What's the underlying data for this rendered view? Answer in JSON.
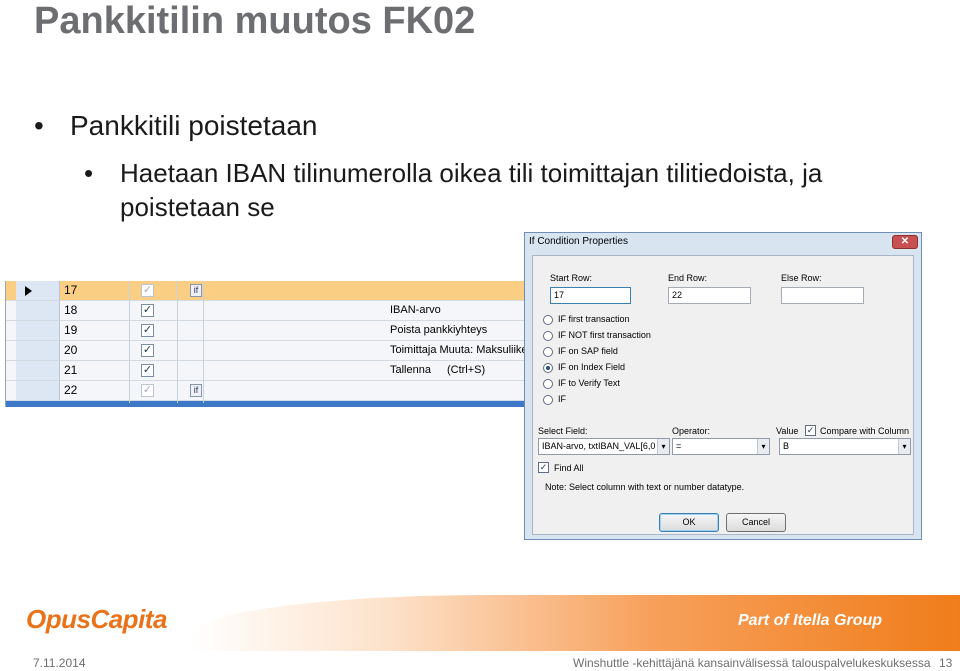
{
  "slide": {
    "title": "Pankkitilin muutos FK02",
    "bullet1": "Pankkitili poistetaan",
    "bullet2": "Haetaan IBAN tilinumerolla oikea tili toimittajan tilitiedoista, ja poistetaan se"
  },
  "grid": {
    "rows": [
      {
        "num": "17",
        "checked": false,
        "icon": "if",
        "text": ""
      },
      {
        "num": "18",
        "checked": true,
        "icon": "",
        "text": "IBAN-arvo"
      },
      {
        "num": "19",
        "checked": true,
        "icon": "",
        "text": "Poista pankkiyhteys"
      },
      {
        "num": "20",
        "checked": true,
        "icon": "",
        "text": "Toimittaja Muuta: Maksuliikenn"
      },
      {
        "num": "21",
        "checked": true,
        "icon": "",
        "text": "Tallenna",
        "shortcut": "(Ctrl+S)"
      },
      {
        "num": "22",
        "checked": false,
        "icon": "if",
        "text": ""
      }
    ]
  },
  "dialog": {
    "title": "If Condition Properties",
    "close": "✕",
    "start_row_label": "Start Row:",
    "start_row_value": "17",
    "end_row_label": "End Row:",
    "end_row_value": "22",
    "else_row_label": "Else Row:",
    "else_row_value": "",
    "options": [
      "IF first transaction",
      "IF NOT first transaction",
      "IF on SAP field",
      "IF on Index Field",
      "IF to Verify Text",
      "IF"
    ],
    "selected_option": "IF on Index Field",
    "select_field_label": "Select Field:",
    "select_field_value": "IBAN-arvo, txtIBAN_VAL[6,0",
    "operator_label": "Operator:",
    "operator_value": "=",
    "value_label": "Value",
    "value_value": "B",
    "compare_label": "Compare with Column",
    "find_all_label": "Find All",
    "note": "Note: Select column with text or number datatype.",
    "ok": "OK",
    "cancel": "Cancel"
  },
  "footer": {
    "logo": "OpusCapita",
    "itella": "Part of Itella Group",
    "date": "7.11.2014",
    "text": "Winshuttle -kehittäjänä kansainvälisessä talouspalvelukeskuksessa",
    "page": "13"
  },
  "colors": {
    "title": "#6d6e71",
    "accent": "#f07d1a",
    "grid_selected_row": "#fbcf83"
  }
}
